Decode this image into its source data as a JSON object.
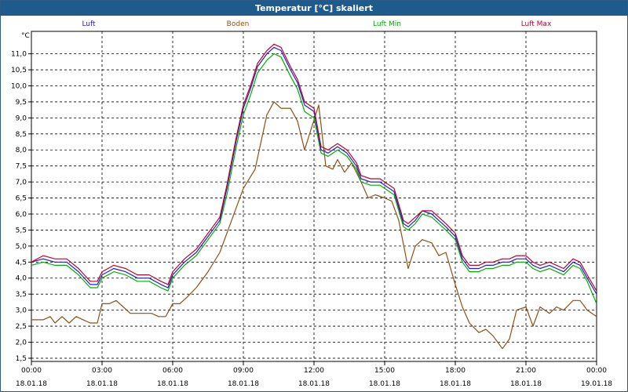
{
  "window": {
    "title": "Temperatur [°C] skaliert"
  },
  "chart_data": {
    "type": "line",
    "title": "Temperatur [°C] skaliert",
    "ylabel": "°C",
    "xlabel": "",
    "xlim": [
      0,
      24
    ],
    "ylim": [
      1.4,
      11.7
    ],
    "grid": true,
    "legend_position": "top",
    "yticks": [
      1.5,
      2.0,
      2.5,
      3.0,
      3.5,
      4.0,
      4.5,
      5.0,
      5.5,
      6.0,
      6.5,
      7.0,
      7.5,
      8.0,
      8.5,
      9.0,
      9.5,
      10.0,
      10.5,
      11.0
    ],
    "ytick_labels": [
      "1,5",
      "2,0",
      "2,5",
      "3,0",
      "3,5",
      "4,0",
      "4,5",
      "5,0",
      "5,5",
      "6,0",
      "6,5",
      "7,0",
      "7,5",
      "8,0",
      "8,5",
      "9,0",
      "9,5",
      "10,0",
      "10,5",
      "11,0"
    ],
    "xticks": [
      0,
      3,
      6,
      9,
      12,
      15,
      18,
      21,
      24
    ],
    "xtick_times": [
      "00:00",
      "03:00",
      "06:00",
      "09:00",
      "12:00",
      "15:00",
      "18:00",
      "21:00",
      "00:00"
    ],
    "xtick_dates": [
      "18.01.18",
      "18.01.18",
      "18.01.18",
      "18.01.18",
      "18.01.18",
      "18.01.18",
      "18.01.18",
      "18.01.18",
      "19.01.18"
    ],
    "series": [
      {
        "name": "Luft",
        "color": "#2020c0",
        "x": [
          0,
          0.5,
          1,
          1.5,
          2,
          2.5,
          2.8,
          3,
          3.5,
          4,
          4.5,
          5,
          5.5,
          5.8,
          6,
          6.5,
          7,
          7.5,
          7.8,
          8,
          8.3,
          8.7,
          9,
          9.3,
          9.6,
          10,
          10.3,
          10.6,
          11,
          11.3,
          11.6,
          12,
          12.3,
          12.6,
          13,
          13.4,
          13.8,
          14,
          14.4,
          14.8,
          15,
          15.4,
          15.8,
          16,
          16.3,
          16.6,
          17,
          17.3,
          17.6,
          18,
          18.3,
          18.6,
          19,
          19.3,
          19.6,
          20,
          20.3,
          20.6,
          21,
          21.3,
          21.6,
          22,
          22.3,
          22.6,
          23,
          23.3,
          23.6,
          24
        ],
        "y": [
          4.5,
          4.6,
          4.5,
          4.5,
          4.2,
          3.8,
          3.8,
          4.1,
          4.3,
          4.2,
          4.0,
          4.0,
          3.8,
          3.7,
          4.1,
          4.5,
          4.8,
          5.3,
          5.6,
          5.8,
          6.8,
          8.3,
          9.3,
          9.9,
          10.6,
          11.0,
          11.2,
          11.1,
          10.5,
          10.1,
          9.4,
          9.2,
          8.0,
          7.9,
          8.1,
          7.9,
          7.5,
          7.1,
          7.0,
          7.0,
          6.9,
          6.7,
          5.7,
          5.6,
          5.8,
          6.1,
          6.0,
          5.8,
          5.6,
          5.3,
          4.6,
          4.3,
          4.3,
          4.4,
          4.4,
          4.5,
          4.5,
          4.6,
          4.6,
          4.4,
          4.3,
          4.4,
          4.3,
          4.2,
          4.5,
          4.4,
          4.0,
          3.5
        ]
      },
      {
        "name": "Boden",
        "color": "#905010",
        "x": [
          0,
          0.5,
          0.8,
          1,
          1.3,
          1.6,
          1.9,
          2.2,
          2.5,
          2.8,
          3,
          3.3,
          3.6,
          3.9,
          4.2,
          4.5,
          4.8,
          5.1,
          5.4,
          5.7,
          6,
          6.3,
          6.6,
          7,
          7.5,
          8,
          8.5,
          9,
          9.5,
          10,
          10.3,
          10.6,
          11,
          11.3,
          11.6,
          11.9,
          12.2,
          12.5,
          12.8,
          13,
          13.3,
          13.6,
          14,
          14.3,
          14.6,
          15,
          15.3,
          15.6,
          16,
          16.3,
          16.6,
          17,
          17.3,
          17.6,
          18,
          18.3,
          18.6,
          19,
          19.3,
          19.6,
          20,
          20.3,
          20.6,
          21,
          21.3,
          21.6,
          22,
          22.3,
          22.6,
          23,
          23.3,
          23.6,
          24
        ],
        "y": [
          2.7,
          2.7,
          2.8,
          2.6,
          2.8,
          2.6,
          2.8,
          2.7,
          2.6,
          2.6,
          3.2,
          3.2,
          3.3,
          3.1,
          2.9,
          2.9,
          2.9,
          2.9,
          2.8,
          2.8,
          3.2,
          3.2,
          3.4,
          3.7,
          4.2,
          4.8,
          5.8,
          6.8,
          7.4,
          9.1,
          9.5,
          9.3,
          9.3,
          8.9,
          8.0,
          8.7,
          9.4,
          7.5,
          7.4,
          7.7,
          7.3,
          7.6,
          7.0,
          6.5,
          6.6,
          6.5,
          6.4,
          5.8,
          4.3,
          5.0,
          5.2,
          5.1,
          4.7,
          4.8,
          3.8,
          3.1,
          2.6,
          2.3,
          2.4,
          2.2,
          1.8,
          2.1,
          3.0,
          3.1,
          2.5,
          3.1,
          2.9,
          3.1,
          3.0,
          3.3,
          3.3,
          3.0,
          2.8
        ]
      },
      {
        "name": "Luft Min",
        "color": "#00b000",
        "x": [
          0,
          0.5,
          1,
          1.5,
          2,
          2.5,
          2.8,
          3,
          3.5,
          4,
          4.5,
          5,
          5.5,
          5.8,
          6,
          6.5,
          7,
          7.5,
          7.8,
          8,
          8.3,
          8.7,
          9,
          9.3,
          9.6,
          10,
          10.3,
          10.6,
          11,
          11.3,
          11.6,
          12,
          12.3,
          12.6,
          13,
          13.4,
          13.8,
          14,
          14.4,
          14.8,
          15,
          15.4,
          15.8,
          16,
          16.3,
          16.6,
          17,
          17.3,
          17.6,
          18,
          18.3,
          18.6,
          19,
          19.3,
          19.6,
          20,
          20.3,
          20.6,
          21,
          21.3,
          21.6,
          22,
          22.3,
          22.6,
          23,
          23.3,
          23.6,
          24
        ],
        "y": [
          4.4,
          4.5,
          4.4,
          4.4,
          4.1,
          3.7,
          3.7,
          4.0,
          4.2,
          4.1,
          3.9,
          3.9,
          3.7,
          3.6,
          4.0,
          4.4,
          4.7,
          5.2,
          5.5,
          5.7,
          6.6,
          8.1,
          9.1,
          9.7,
          10.4,
          10.8,
          11.0,
          10.9,
          10.3,
          9.9,
          9.2,
          9.0,
          7.9,
          7.8,
          8.0,
          7.8,
          7.4,
          7.0,
          6.9,
          6.9,
          6.8,
          6.6,
          5.6,
          5.5,
          5.7,
          6.0,
          5.9,
          5.7,
          5.5,
          5.2,
          4.5,
          4.2,
          4.2,
          4.3,
          4.3,
          4.4,
          4.4,
          4.5,
          4.5,
          4.3,
          4.2,
          4.3,
          4.2,
          4.1,
          4.4,
          4.3,
          3.9,
          3.2
        ]
      },
      {
        "name": "Luft Max",
        "color": "#c00030",
        "x": [
          0,
          0.5,
          1,
          1.5,
          2,
          2.5,
          2.8,
          3,
          3.5,
          4,
          4.5,
          5,
          5.5,
          5.8,
          6,
          6.5,
          7,
          7.5,
          7.8,
          8,
          8.3,
          8.7,
          9,
          9.3,
          9.6,
          10,
          10.3,
          10.6,
          11,
          11.3,
          11.6,
          12,
          12.3,
          12.6,
          13,
          13.4,
          13.8,
          14,
          14.4,
          14.8,
          15,
          15.4,
          15.8,
          16,
          16.3,
          16.6,
          17,
          17.3,
          17.6,
          18,
          18.3,
          18.6,
          19,
          19.3,
          19.6,
          20,
          20.3,
          20.6,
          21,
          21.3,
          21.6,
          22,
          22.3,
          22.6,
          23,
          23.3,
          23.6,
          24
        ],
        "y": [
          4.5,
          4.7,
          4.6,
          4.6,
          4.3,
          3.9,
          3.9,
          4.2,
          4.4,
          4.3,
          4.1,
          4.1,
          3.9,
          3.8,
          4.2,
          4.6,
          4.9,
          5.4,
          5.7,
          5.9,
          6.9,
          8.4,
          9.4,
          10.0,
          10.7,
          11.1,
          11.3,
          11.2,
          10.6,
          10.2,
          9.5,
          9.3,
          8.1,
          8.0,
          8.2,
          8.0,
          7.6,
          7.2,
          7.1,
          7.1,
          7.0,
          6.8,
          5.8,
          5.7,
          5.9,
          6.1,
          6.1,
          5.9,
          5.7,
          5.4,
          4.7,
          4.4,
          4.4,
          4.5,
          4.5,
          4.6,
          4.6,
          4.7,
          4.7,
          4.5,
          4.4,
          4.5,
          4.4,
          4.3,
          4.6,
          4.5,
          4.1,
          3.6
        ]
      }
    ]
  }
}
